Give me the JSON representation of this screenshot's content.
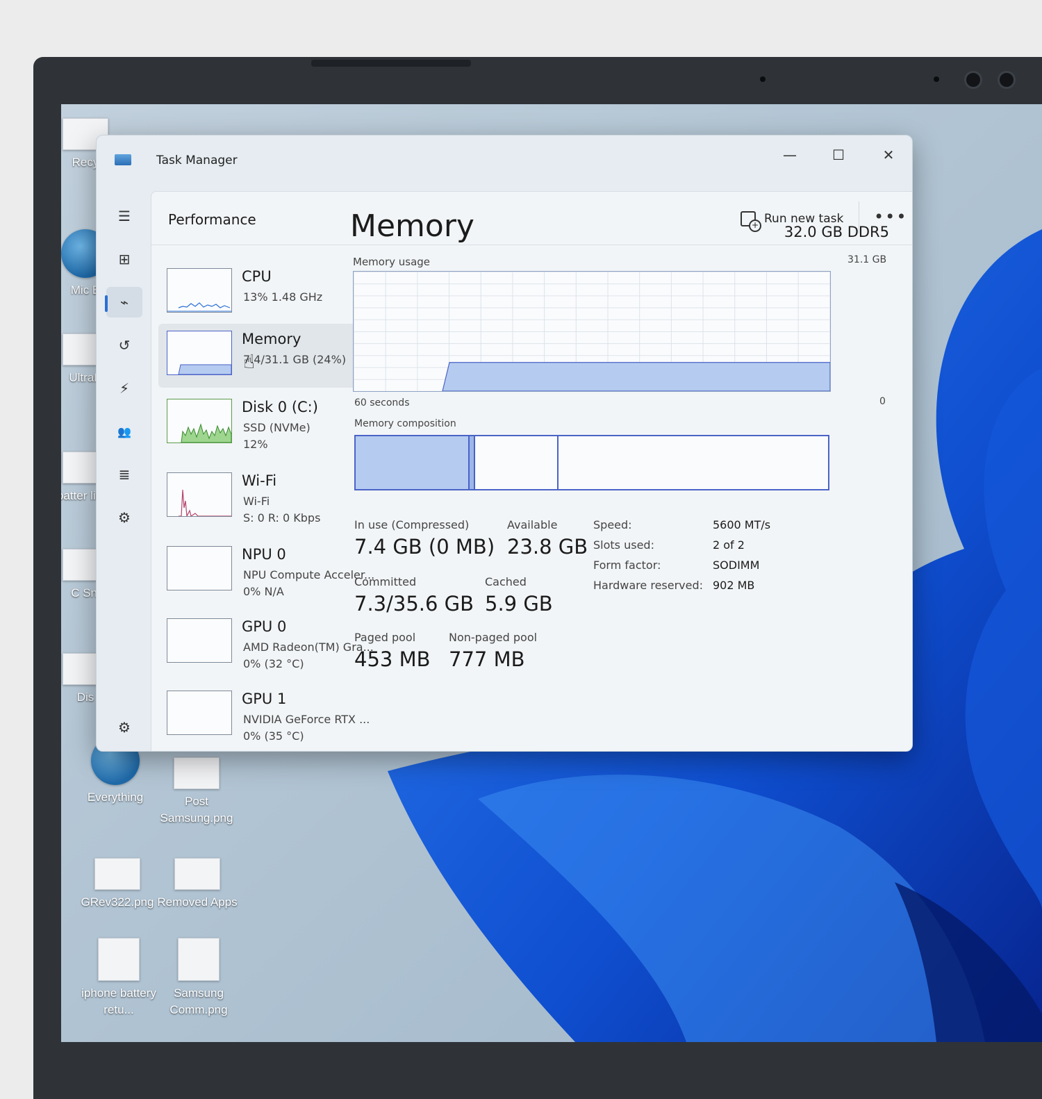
{
  "desktop": {
    "icons": [
      {
        "label": "Recy"
      },
      {
        "label": "Mic E"
      },
      {
        "label": "UltraP"
      },
      {
        "label": "batter listin"
      },
      {
        "label": "C Sni"
      },
      {
        "label": "Dis"
      },
      {
        "label": "Everything"
      },
      {
        "label": "Post Samsung.png"
      },
      {
        "label": "GRev322.png"
      },
      {
        "label": "Removed Apps"
      },
      {
        "label": "iphone battery retu..."
      },
      {
        "label": "Samsung Comm.png"
      }
    ]
  },
  "window": {
    "title": "Task Manager",
    "minimize": "—",
    "maximize": "☐",
    "close": "✕"
  },
  "nav": {
    "items": [
      {
        "icon": "hamburger-icon",
        "glyph": "☰"
      },
      {
        "icon": "processes-icon",
        "glyph": "⊞"
      },
      {
        "icon": "performance-icon",
        "glyph": "⌁"
      },
      {
        "icon": "app-history-icon",
        "glyph": "↺"
      },
      {
        "icon": "startup-apps-icon",
        "glyph": "⚡"
      },
      {
        "icon": "users-icon",
        "glyph": "👥"
      },
      {
        "icon": "details-icon",
        "glyph": "≣"
      },
      {
        "icon": "services-icon",
        "glyph": "⚙"
      }
    ],
    "settings_glyph": "⚙"
  },
  "header": {
    "title": "Performance",
    "run_new_task": "Run new task",
    "more": "•••"
  },
  "resources": [
    {
      "name": "CPU",
      "line1": "13%  1.48 GHz",
      "line2": ""
    },
    {
      "name": "Memory",
      "line1": "7.4/31.1 GB (24%)",
      "line2": ""
    },
    {
      "name": "Disk 0 (C:)",
      "line1": "SSD (NVMe)",
      "line2": "12%"
    },
    {
      "name": "Wi-Fi",
      "line1": "Wi-Fi",
      "line2": "S: 0  R: 0 Kbps"
    },
    {
      "name": "NPU 0",
      "line1": "NPU Compute Acceler...",
      "line2": "0%  N/A"
    },
    {
      "name": "GPU 0",
      "line1": "AMD Radeon(TM) Gra...",
      "line2": "0%  (32 °C)"
    },
    {
      "name": "GPU 1",
      "line1": "NVIDIA GeForce RTX ...",
      "line2": "0%  (35 °C)"
    }
  ],
  "detail": {
    "title": "Memory",
    "total": "32.0 GB DDR5",
    "usage_label": "Memory usage",
    "usage_max": "31.1 GB",
    "usage_fraction": 0.24,
    "x_left": "60 seconds",
    "x_right": "0",
    "composition_label": "Memory composition",
    "stats": {
      "in_use_label": "In use (Compressed)",
      "in_use_value": "7.4 GB (0 MB)",
      "available_label": "Available",
      "available_value": "23.8 GB",
      "committed_label": "Committed",
      "committed_value": "7.3/35.6 GB",
      "cached_label": "Cached",
      "cached_value": "5.9 GB",
      "paged_label": "Paged pool",
      "paged_value": "453 MB",
      "nonpaged_label": "Non-paged pool",
      "nonpaged_value": "777 MB"
    },
    "props": [
      {
        "k": "Speed:",
        "v": "5600 MT/s"
      },
      {
        "k": "Slots used:",
        "v": "2 of 2"
      },
      {
        "k": "Form factor:",
        "v": "SODIMM"
      },
      {
        "k": "Hardware reserved:",
        "v": "902 MB"
      }
    ]
  },
  "colors": {
    "accent": "#2b6fd6",
    "memory_fill": "#b5cbf0",
    "memory_line": "#4a63c7",
    "disk_fill": "#9ed68f",
    "wifi_line": "#b3436b"
  }
}
